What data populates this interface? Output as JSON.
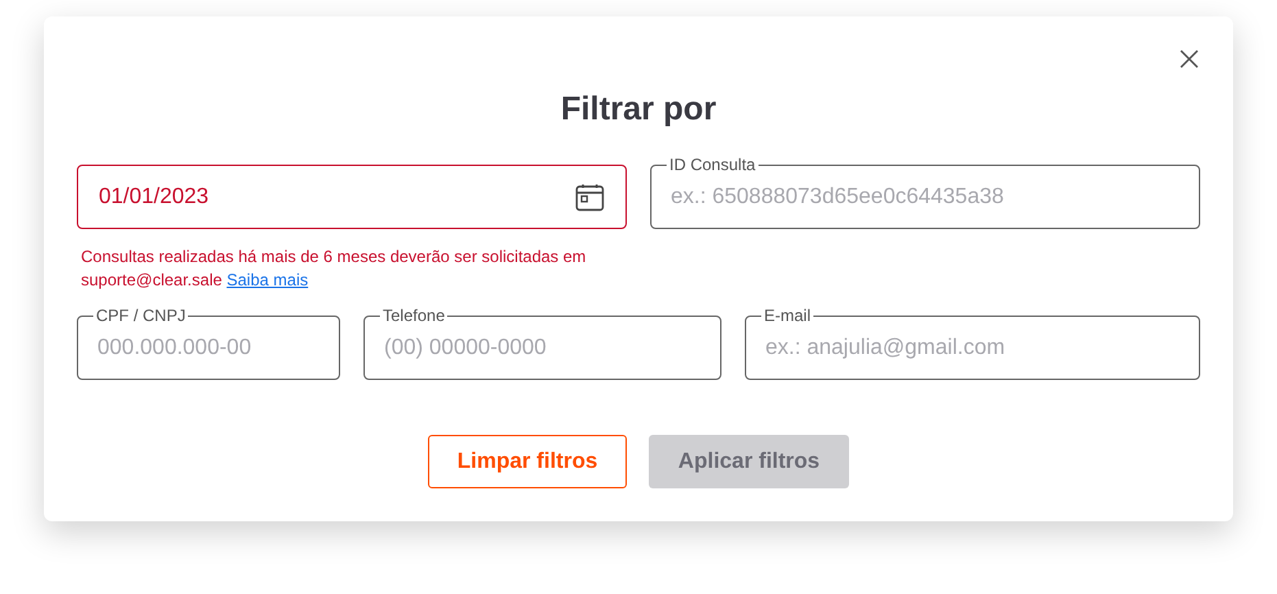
{
  "title": "Filtrar por",
  "rows": [
    {
      "fields": [
        {
          "kind": "date",
          "value": "01/01/2023",
          "error": true
        },
        {
          "kind": "text",
          "label": "ID Consulta",
          "placeholder": "ex.: 650888073d65ee0c64435a38",
          "error": false
        }
      ],
      "message": {
        "text": "Consultas realizadas há mais de 6 meses deverão ser solicitadas em suporte@clear.sale",
        "link": "Saiba mais"
      }
    },
    {
      "fields": [
        {
          "kind": "text",
          "label": "CPF / CNPJ",
          "placeholder": "000.000.000-00",
          "error": false
        },
        {
          "kind": "text",
          "label": "Telefone",
          "placeholder": "(00) 00000-0000",
          "error": false
        },
        {
          "kind": "text",
          "label": "E-mail",
          "placeholder": "ex.: anajulia@gmail.com",
          "error": false
        }
      ]
    }
  ],
  "buttons": [
    {
      "label": "Limpar filtros",
      "kind": "outline",
      "disabled": false
    },
    {
      "label": "Aplicar filtros",
      "kind": "primary",
      "disabled": true
    }
  ]
}
